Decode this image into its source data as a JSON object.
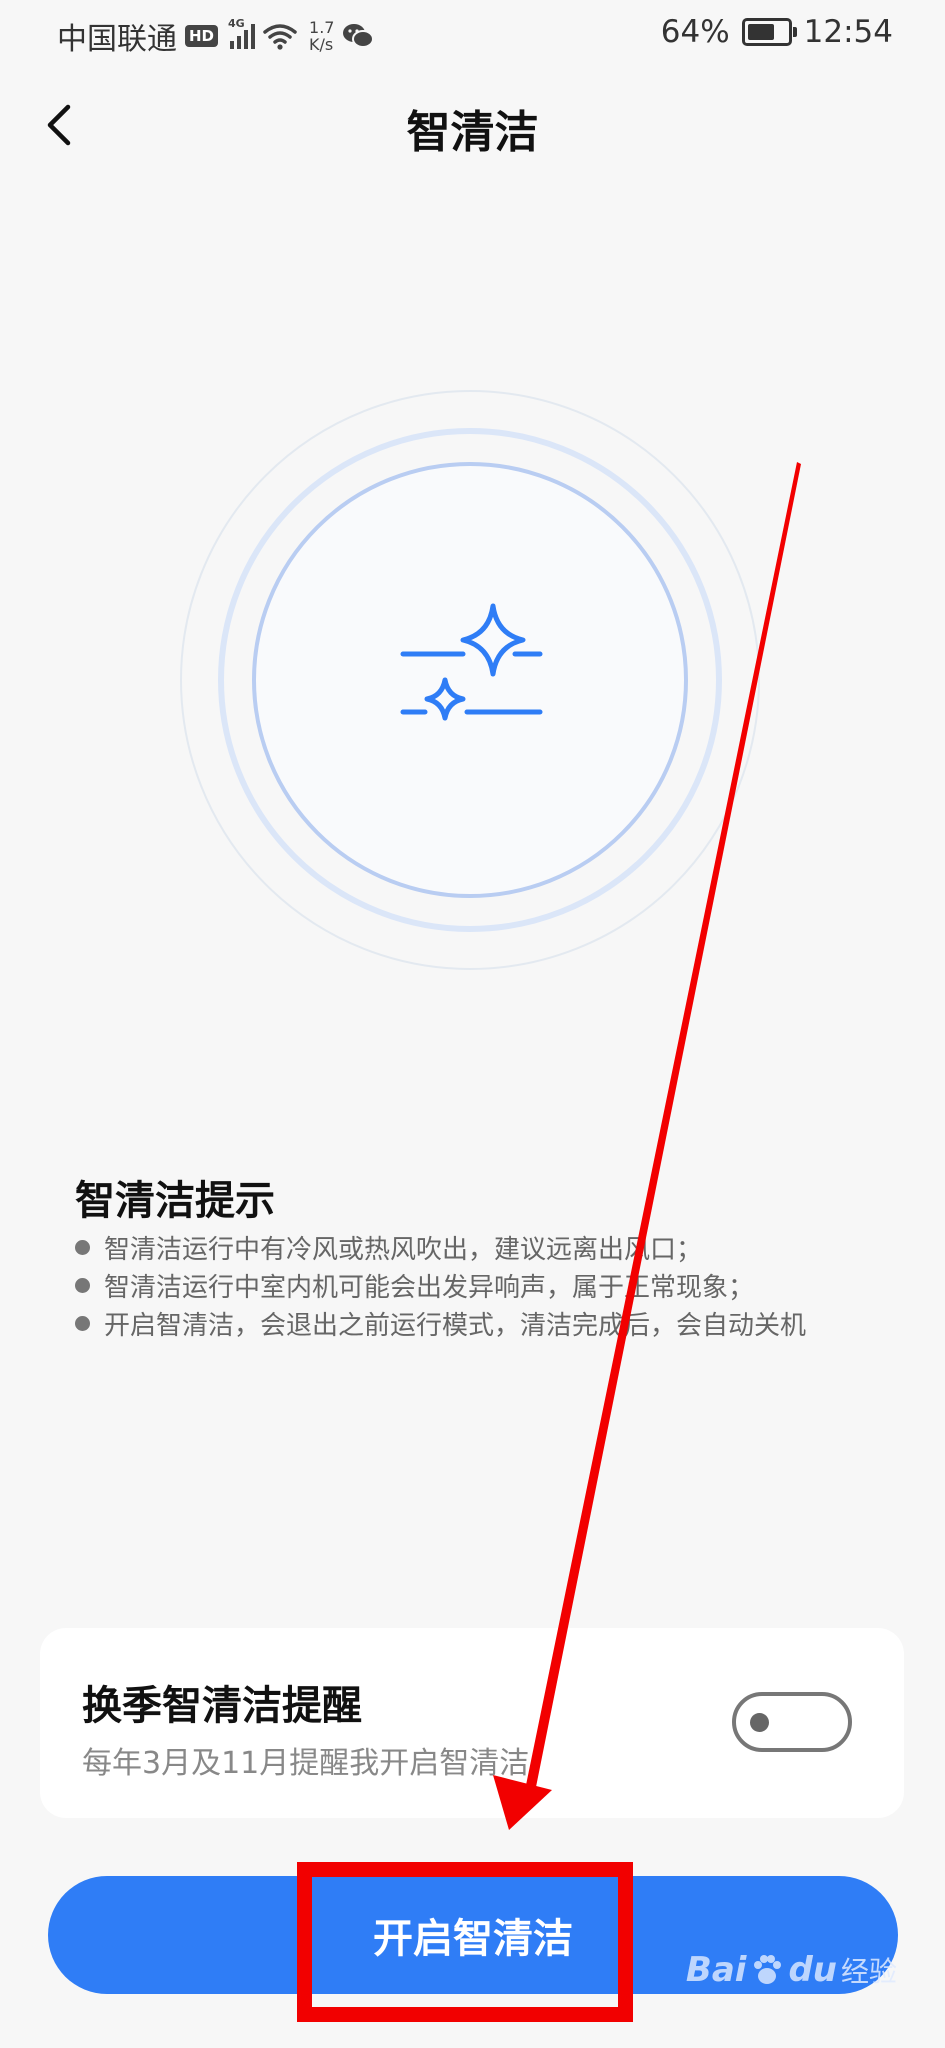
{
  "status_bar": {
    "carrier": "中国联通",
    "hd": "HD",
    "network": "4G",
    "speed_value": "1.7",
    "speed_unit": "K/s",
    "battery": "64%",
    "time": "12:54"
  },
  "header": {
    "title": "智清洁"
  },
  "tips": {
    "title": "智清洁提示",
    "items": [
      "智清洁运行中有冷风或热风吹出，建议远离出风口；",
      "智清洁运行中室内机可能会出发异响声，属于正常现象；",
      "开启智清洁，会退出之前运行模式，清洁完成后，会自动关机"
    ]
  },
  "reminder": {
    "title": "换季智清洁提醒",
    "subtitle": "每年3月及11月提醒我开启智清洁",
    "enabled": false
  },
  "primary_button": {
    "label": "开启智清洁"
  },
  "watermark": {
    "brand": "Bai",
    "brand_suffix": "du",
    "text": "经验"
  },
  "colors": {
    "accent": "#2f7df6",
    "annotation": "#f20000"
  }
}
